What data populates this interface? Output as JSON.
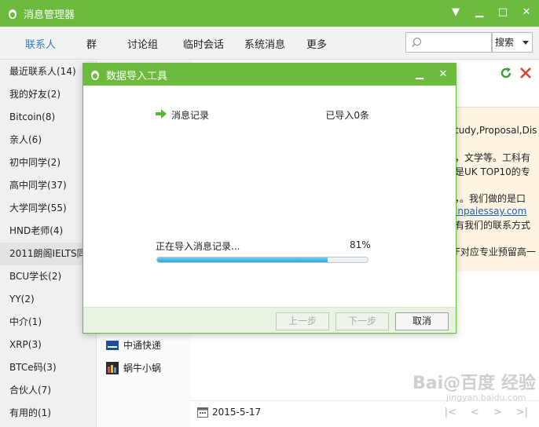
{
  "window": {
    "title": "消息管理器"
  },
  "nav": {
    "tabs": [
      {
        "label": "联系人",
        "active": true
      },
      {
        "label": "群"
      },
      {
        "label": "讨论组"
      },
      {
        "label": "临时会话"
      },
      {
        "label": "系统消息"
      },
      {
        "label": "更多"
      }
    ],
    "search_placeholder": "",
    "search_scope": "搜索"
  },
  "sidebar": {
    "items": [
      "最近联系人(14)",
      "我的好友(2)",
      "Bitcoin(8)",
      "亲人(6)",
      "初中同学(2)",
      "高中同学(37)",
      "大学同学(55)",
      "HND老师(4)",
      "2011朗阁IELTS同..",
      "BCU学长(2)",
      "YY(2)",
      "中介(1)",
      "XRP(3)",
      "BTCe码(3)",
      "合伙人(7)",
      "有用的(1)"
    ],
    "selected_index": 8
  },
  "contacts": {
    "items": [
      {
        "name": "中通快递"
      },
      {
        "name": "蜗牛小蜗"
      }
    ]
  },
  "message_preview": {
    "lines": [
      "tudy,Proposal,Dis",
      "，文学等。工科有",
      "是UK TOP10的专",
      "，。我们做的是口",
      "inpaiessay.com",
      "有我们的联系方式",
      "F对应专业预留高一"
    ],
    "link_index": 4
  },
  "footer": {
    "date": "2015-5-17",
    "watermark": "Bai@百度 经验",
    "watermark_url": "jingyan.baidu.com"
  },
  "dialog": {
    "title": "数据导入工具",
    "record_label": "消息记录",
    "record_status": "已导入0条",
    "progress_label": "正在导入消息记录...",
    "progress_percent_text": "81%",
    "progress_value": 0.81,
    "buttons": {
      "prev": "上一步",
      "next": "下一步",
      "cancel": "取消"
    }
  },
  "colors": {
    "brand_green": "#6dbb3e",
    "link_blue": "#1b5fb1",
    "progress_blue": "#2aa7de"
  }
}
